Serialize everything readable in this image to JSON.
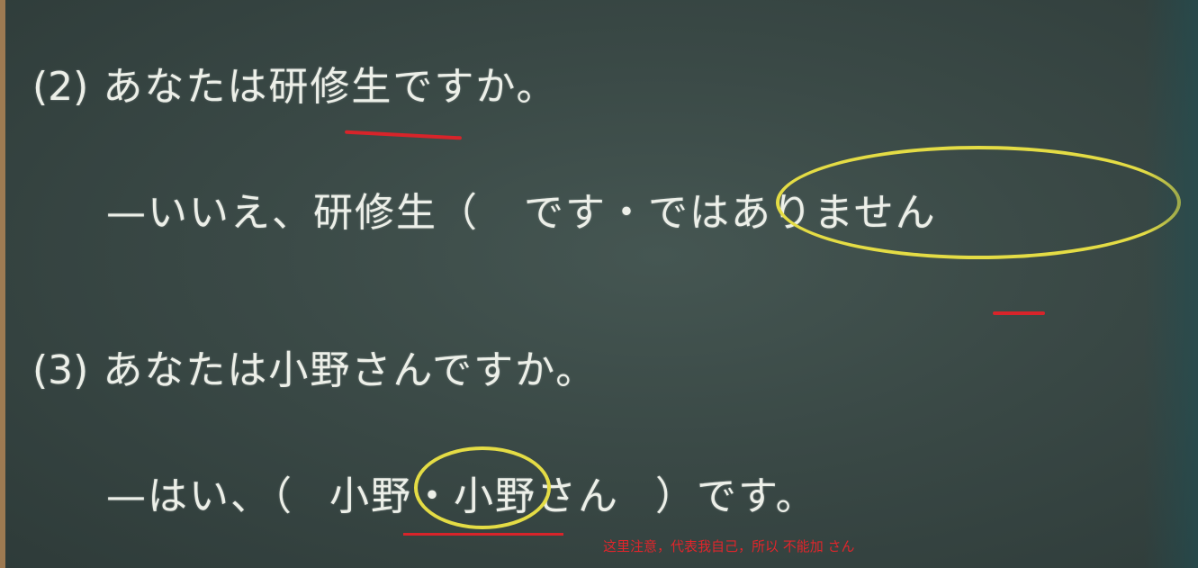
{
  "q2": {
    "number": "(2)",
    "question": "あなたは研修生ですか。",
    "answer_prefix": "—いいえ、研修生（",
    "option_a": "です",
    "separator": "・",
    "option_b": "ではありません"
  },
  "q3": {
    "number": "(3)",
    "question": "あなたは小野さんですか。",
    "answer_prefix": "—はい、（",
    "option_a": "小野",
    "separator": "・",
    "option_b": "小野さん",
    "answer_suffix": "）です。"
  },
  "note": "这里注意，代表我自己，所以 不能加 さん",
  "colors": {
    "board": "#3a4946",
    "chalk": "#ecefe8",
    "highlight_circle": "#e4dc45",
    "annotation_red": "#d8242a"
  }
}
